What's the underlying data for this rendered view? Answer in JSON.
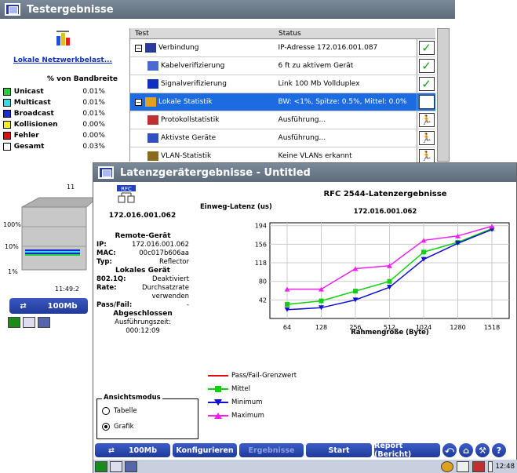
{
  "background_window": {
    "title": "Testergebnisse",
    "app_title": "Lokale Netzwerkbelast...",
    "bandwidth_header": "% von Bandbreite",
    "stats": [
      {
        "name": "Unicast",
        "value": "0.01%",
        "color": "#22d03a"
      },
      {
        "name": "Multicast",
        "value": "0.01%",
        "color": "#30e0e0"
      },
      {
        "name": "Broadcast",
        "value": "0.01%",
        "color": "#1a2fd0"
      },
      {
        "name": "Kollisionen",
        "value": "0.00%",
        "color": "#f0f020"
      },
      {
        "name": "Fehler",
        "value": "0.00%",
        "color": "#e01010"
      },
      {
        "name": "Gesamt",
        "value": "0.03%",
        "color": "#ffffff"
      }
    ],
    "tree_headers": {
      "test": "Test",
      "status": "Status"
    },
    "tree_rows": [
      {
        "label": "Verbindung",
        "status": "IP-Adresse 172.016.001.087",
        "indicator": "check",
        "icon": "monitor-icon"
      },
      {
        "label": "Kabelverifizierung",
        "status": "6 ft zu aktivem Gerät",
        "indicator": "check",
        "icon": "cable-icon"
      },
      {
        "label": "Signalverifizierung",
        "status": "Link 100 Mb Vollduplex",
        "indicator": "check",
        "icon": "arrows-icon"
      },
      {
        "label": "Lokale Statistik",
        "status": "BW: <1%, Spitze: 0.5%, Mittel: 0.0%",
        "indicator": "bar",
        "icon": "chart-icon"
      },
      {
        "label": "Protokollstatistik",
        "status": "Ausführung...",
        "indicator": "running",
        "icon": "protocol-icon"
      },
      {
        "label": "Aktivste Geräte",
        "status": "Ausführung...",
        "indicator": "running",
        "icon": "computer-icon"
      },
      {
        "label": "VLAN-Statistik",
        "status": "Keine VLANs erkannt",
        "indicator": "running",
        "icon": "vlan-icon"
      }
    ],
    "graph_labels": [
      "100%",
      "10%",
      "1%"
    ],
    "graph_top_label": "11",
    "graph_time": "11:49:2",
    "speed_button": "100Mb"
  },
  "window": {
    "title": "Latenzgerätergebnisse - Untitled",
    "rfc_icon_label": "RFC",
    "ip": "172.016.001.062",
    "remote_title": "Remote-Gerät",
    "remote": {
      "ip_label": "IP:",
      "ip": "172.016.001.062",
      "mac_label": "MAC:",
      "mac": "00c017b606aa",
      "type_label": "Typ:",
      "type": "Reflector"
    },
    "local_title": "Lokales Gerät",
    "local": {
      "q_label": "802.1Q:",
      "q": "Deaktiviert",
      "rate_label": "Rate:",
      "rate_1": "Durchsatzrate",
      "rate_2": "verwenden",
      "pf_label": "Pass/Fail:",
      "pf": "-"
    },
    "status": "Abgeschlossen",
    "runtime": "Ausführungszeit: 000:12:09"
  },
  "chart_data": {
    "type": "line",
    "title": "RFC 2544-Latenzergebnisse",
    "subtitle": "172.016.001.062",
    "xlabel": "Rahmengröße (Byte)",
    "ylabel": "Einweg-Latenz (us)",
    "categories": [
      "64",
      "128",
      "256",
      "512",
      "1024",
      "1280",
      "1518"
    ],
    "yticks": [
      42,
      80,
      118,
      156,
      194
    ],
    "ylim": [
      4,
      200
    ],
    "grid": true,
    "series": [
      {
        "name": "Pass/Fail-Grenzwert",
        "color": "#e01010",
        "marker": "none",
        "values": []
      },
      {
        "name": "Mittel",
        "color": "#10d010",
        "marker": "square",
        "values": [
          33,
          40,
          60,
          80,
          140,
          160,
          188
        ]
      },
      {
        "name": "Minimum",
        "color": "#1010d0",
        "marker": "triangle-down",
        "values": [
          22,
          26,
          42,
          68,
          125,
          158,
          186
        ]
      },
      {
        "name": "Maximum",
        "color": "#f020f0",
        "marker": "triangle-up",
        "values": [
          64,
          64,
          106,
          112,
          164,
          173,
          193
        ]
      }
    ]
  },
  "view_mode": {
    "title": "Ansichtsmodus",
    "options": [
      {
        "label": "Tabelle",
        "selected": false
      },
      {
        "label": "Grafik",
        "selected": true
      }
    ]
  },
  "toolbar": {
    "speed": "100Mb",
    "configure": "Konfigurieren",
    "results": "Ergebnisse",
    "start": "Start",
    "report": "Report (Bericht)",
    "icons": [
      "back-icon",
      "home-icon",
      "tools-icon",
      "help-icon"
    ]
  },
  "taskbar": {
    "time": "12:48"
  }
}
